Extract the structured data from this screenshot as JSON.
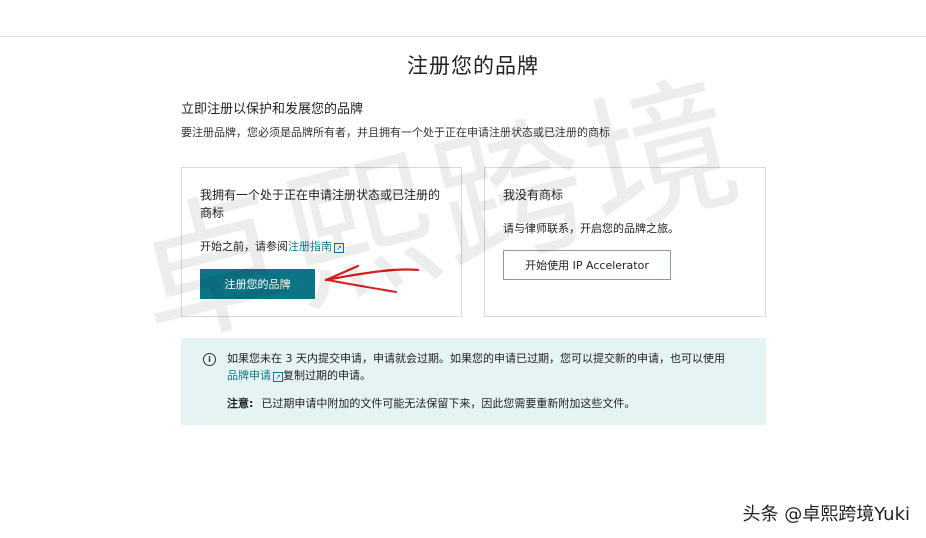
{
  "page": {
    "title": "注册您的品牌"
  },
  "intro": {
    "heading": "立即注册以保护和发展您的品牌",
    "description": "要注册品牌，您必须是品牌所有者，并且拥有一个处于正在申请注册状态或已注册的商标"
  },
  "cards": [
    {
      "title": "我拥有一个处于正在申请注册状态或已注册的商标",
      "sub_prefix": "开始之前，请参阅",
      "link_label": "注册指南",
      "button_label": "注册您的品牌"
    },
    {
      "title": "我没有商标",
      "sub": "请与律师联系，开启您的品牌之旅。",
      "button_label": "开始使用 IP Accelerator"
    }
  ],
  "notice": {
    "line1": "如果您未在 3 天内提交申请，申请就会过期。如果您的申请已过期，您可以提交新的申请，也可以使用",
    "link_label": "品牌申请",
    "line2_suffix": "复制过期的申请。",
    "note_label": "注意:",
    "note_text": "已过期申请中附加的文件可能无法保留下来，因此您需要重新附加这些文件。"
  },
  "watermark": "卓熙跨境",
  "footer_credit": "头条 @卓熙跨境Yuki"
}
